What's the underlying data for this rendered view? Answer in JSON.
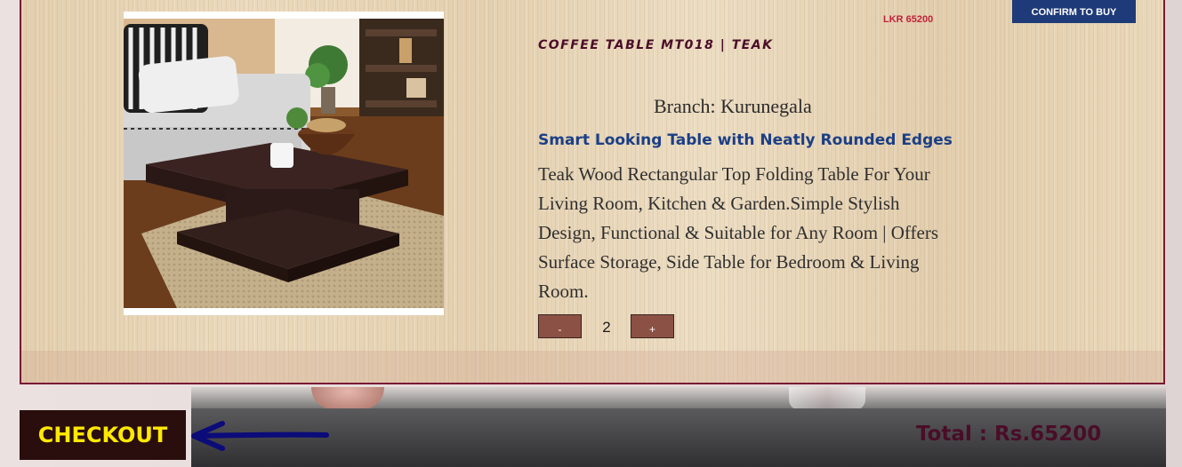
{
  "product": {
    "price": "LKR 65200",
    "name": "COFFEE TABLE MT018 | TEAK",
    "branch": "Branch: Kurunegala",
    "tagline": "Smart Looking Table with Neatly Rounded Edges",
    "description": "Teak Wood Rectangular Top Folding Table For Your Living Room, Kitchen & Garden.Simple Stylish Design, Functional & Suitable for Any Room | Offers Surface Storage, Side Table for Bedroom & Living Room.",
    "image_icon": "coffee-table-photo"
  },
  "actions": {
    "confirm_label": "CONFIRM TO BUY",
    "checkout_label": "CHECKOUT"
  },
  "quantity": {
    "minus_label": "-",
    "value": "2",
    "plus_label": "+"
  },
  "summary": {
    "total": "Total : Rs.65200"
  },
  "colors": {
    "accent_border": "#7a1a34",
    "confirm_bg": "#1e3a78",
    "checkout_bg": "#2a0e0e",
    "checkout_text": "#ffe900",
    "tagline": "#1b3f86",
    "arrow": "#0b0b7a",
    "price": "#c0223c"
  }
}
